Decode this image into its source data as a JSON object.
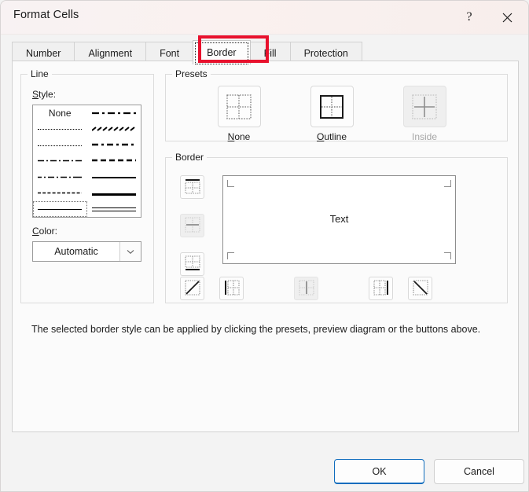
{
  "window": {
    "title": "Format Cells",
    "help_icon": "question-mark-icon",
    "close_icon": "close-icon"
  },
  "tabs": [
    {
      "label": "Number",
      "selected": false
    },
    {
      "label": "Alignment",
      "selected": false
    },
    {
      "label": "Font",
      "selected": false
    },
    {
      "label": "Border",
      "selected": true
    },
    {
      "label": "Fill",
      "selected": false
    },
    {
      "label": "Protection",
      "selected": false
    }
  ],
  "annotation": {
    "color": "#e8112d",
    "target": "Border"
  },
  "line_group": {
    "legend": "Line",
    "style_label": "Style:",
    "style_accel": "S",
    "none_label": "None",
    "styles": [
      {
        "id": "none",
        "column": "left",
        "row": 1,
        "pattern": "none",
        "selected": false
      },
      {
        "id": "hairline-dotted",
        "column": "left",
        "row": 2,
        "pattern": "fine-dotted",
        "selected": false
      },
      {
        "id": "dotted",
        "column": "left",
        "row": 3,
        "pattern": "dotted",
        "selected": false
      },
      {
        "id": "dash-dot-dot",
        "column": "left",
        "row": 4,
        "pattern": "dash-dot-dot",
        "selected": false
      },
      {
        "id": "dash-dot",
        "column": "left",
        "row": 5,
        "pattern": "dash-dot",
        "selected": false
      },
      {
        "id": "dashed-fine",
        "column": "left",
        "row": 6,
        "pattern": "dashed-fine",
        "selected": false
      },
      {
        "id": "thin-solid",
        "column": "left",
        "row": 7,
        "pattern": "thin-solid",
        "selected": true
      },
      {
        "id": "dash-dot-bold",
        "column": "right",
        "row": 1,
        "pattern": "dash-dot-medium",
        "selected": false
      },
      {
        "id": "slant-dash",
        "column": "right",
        "row": 2,
        "pattern": "slant-dash",
        "selected": false
      },
      {
        "id": "dash-dot-heavy",
        "column": "right",
        "row": 3,
        "pattern": "dash-dot-heavy",
        "selected": false
      },
      {
        "id": "dashed-heavy",
        "column": "right",
        "row": 4,
        "pattern": "dashed-heavy",
        "selected": false
      },
      {
        "id": "medium-solid",
        "column": "right",
        "row": 5,
        "pattern": "medium-solid",
        "selected": false
      },
      {
        "id": "thick-solid",
        "column": "right",
        "row": 6,
        "pattern": "thick-solid",
        "selected": false
      },
      {
        "id": "double",
        "column": "right",
        "row": 7,
        "pattern": "double",
        "selected": false
      }
    ],
    "color_label": "Color:",
    "color_accel": "C",
    "color_value": "Automatic",
    "color_arrow_icon": "chevron-down-icon"
  },
  "presets": {
    "legend": "Presets",
    "items": [
      {
        "id": "none",
        "label": "None",
        "accel": "N",
        "icon": "preset-none-icon",
        "disabled": false
      },
      {
        "id": "outline",
        "label": "Outline",
        "accel": "O",
        "icon": "preset-outline-icon",
        "disabled": false
      },
      {
        "id": "inside",
        "label": "Inside",
        "accel": "I",
        "icon": "preset-inside-icon",
        "disabled": true
      }
    ]
  },
  "border": {
    "legend": "Border",
    "preview_text": "Text",
    "side_buttons": [
      {
        "id": "top",
        "icon": "border-top-icon",
        "disabled": false
      },
      {
        "id": "horizontal",
        "icon": "border-horizontal-icon",
        "disabled": true
      },
      {
        "id": "bottom",
        "icon": "border-bottom-icon",
        "disabled": false
      }
    ],
    "bottom_buttons": [
      {
        "id": "diagonal-up",
        "icon": "border-diagonal-up-icon",
        "disabled": false
      },
      {
        "id": "left",
        "icon": "border-left-icon",
        "disabled": false
      },
      {
        "id": "vertical",
        "icon": "border-vertical-icon",
        "disabled": true
      },
      {
        "id": "right",
        "icon": "border-right-icon",
        "disabled": false
      },
      {
        "id": "diagonal-down",
        "icon": "border-diagonal-down-icon",
        "disabled": false
      }
    ]
  },
  "help_text": "The selected border style can be applied by clicking the presets, preview diagram or the buttons above.",
  "footer": {
    "ok_label": "OK",
    "cancel_label": "Cancel",
    "default_accent": "#0f6cbd"
  }
}
